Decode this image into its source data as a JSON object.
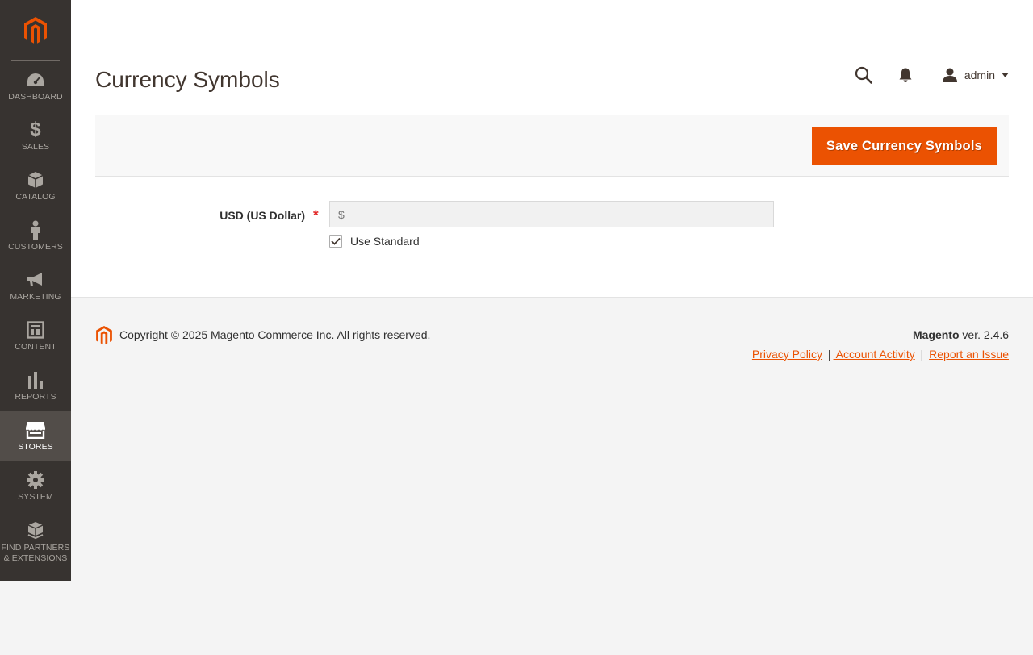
{
  "sidebar": {
    "logo": "magento-logo",
    "items": [
      {
        "label": "Dashboard",
        "icon": "dashboard-icon"
      },
      {
        "label": "Sales",
        "icon": "dollar-icon"
      },
      {
        "label": "Catalog",
        "icon": "cube-icon"
      },
      {
        "label": "Customers",
        "icon": "person-icon"
      },
      {
        "label": "Marketing",
        "icon": "megaphone-icon"
      },
      {
        "label": "Content",
        "icon": "layout-icon"
      },
      {
        "label": "Reports",
        "icon": "bar-chart-icon"
      },
      {
        "label": "Stores",
        "icon": "storefront-icon",
        "active": true
      },
      {
        "label": "System",
        "icon": "gear-icon"
      },
      {
        "label": "Find Partners & Extensions",
        "icon": "boxes-icon"
      }
    ]
  },
  "header": {
    "title": "Currency Symbols",
    "user": "admin"
  },
  "actions": {
    "save_label": "Save Currency Symbols"
  },
  "form": {
    "field_label": "USD (US Dollar)",
    "required_mark": "*",
    "placeholder": "$",
    "use_standard_label": "Use Standard",
    "use_standard_checked": true
  },
  "footer": {
    "copyright": "Copyright © 2025 Magento Commerce Inc. All rights reserved.",
    "brand": "Magento",
    "version": " ver. 2.4.6",
    "links": {
      "privacy": "Privacy Policy",
      "activity": " Account Activity",
      "report": "Report an Issue"
    },
    "separator": "|"
  },
  "colors": {
    "accent": "#eb5202",
    "sidebar_bg": "#373330",
    "sidebar_active": "#524d49",
    "required": "#e22626"
  }
}
